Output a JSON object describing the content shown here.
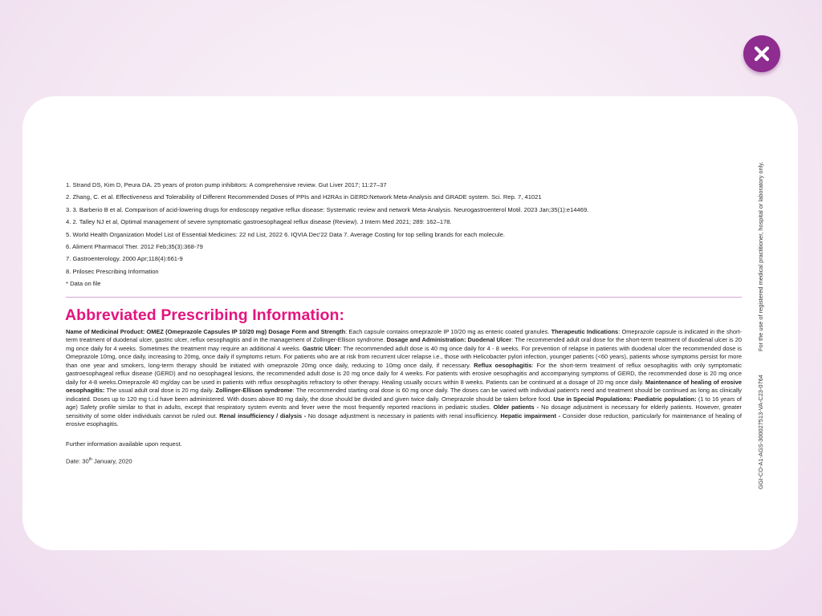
{
  "close_button": {
    "label": "close"
  },
  "references": [
    "1. Strand DS, Kim D, Peura DA. 25 years of proton pump inhibitors: A comprehensive review. Gut Liver 2017; 11:27–37",
    "2. Zhang, C. et al. Effectiveness and Tolerability of Different Recommended Doses of PPIs and H2RAs in GERD:Network Meta-Analysis and GRADE system. Sci. Rep. 7, 41021",
    "3. 3. Barberio B et al. Comparison of acid-lowering drugs for endoscopy negative reflux disease: Systematic review and network Meta-Analysis. Neurogastroenterol Motil. 2023 Jan;35(1):e14469.",
    "4. 2. Talley NJ et al, Optimal management of severe symptomatic gastroesophageal reflux disease (Review). J Intern Med 2021; 289: 162–178.",
    "5. World Health Organization Model List of Essential Medicines: 22 nd List, 2022  6. IQVIA Dec'22 Data  7. Average Costing for top selling brands for each molecule.",
    "6. Aliment Pharmacol Ther. 2012 Feb;35(3):368-79",
    "7. Gastroenterology. 2000 Apr;118(4):661-9",
    "8. Prilosec Prescribing Information",
    "* Data on file"
  ],
  "api": {
    "title": "Abbreviated Prescribing Information:",
    "segments": [
      {
        "bold": true,
        "text": "Name of Medicinal Product: OMEZ (Omeprazole Capsules IP 10/20 mg) Dosage Form and Strength"
      },
      {
        "bold": false,
        "text": ": Each capsule contains omeprazole IP 10/20 mg as enteric coated granules. "
      },
      {
        "bold": true,
        "text": "Therapeutic Indications"
      },
      {
        "bold": false,
        "text": ": Omeprazole capsule is indicated in the short-term treatment of duodenal ulcer, gastric ulcer, reflux oesophagitis and in the management of Zollinger-Ellison syndrome. "
      },
      {
        "bold": true,
        "text": "Dosage and Administration: Duodenal Ulcer"
      },
      {
        "bold": false,
        "text": ": The recommended adult oral dose for the short-term treatment of duodenal ulcer is 20 mg once daily for 4 weeks. Sometimes the treatment may require an additional 4 weeks. "
      },
      {
        "bold": true,
        "text": "Gastric Ulcer"
      },
      {
        "bold": false,
        "text": ": The recommended adult dose is 40 mg once daily for 4 - 8 weeks. For prevention of relapse in patients with duodenal ulcer the recommended dose is Omeprazole 10mg, once daily, increasing to 20mg, once daily if symptoms return. For patients who are at risk from recurrent ulcer relapse i.e., those with Helicobacter pylori infection, younger patients (<60 years), patients whose symptoms persist for more than one year and smokers, long-term therapy should be initiated with omeprazole 20mg once daily, reducing to 10mg once daily, if necessary. "
      },
      {
        "bold": true,
        "text": "Reflux oesophagitis"
      },
      {
        "bold": false,
        "text": ": For the short-term treatment of reflux oesophagitis with only symptomatic gastroesophageal reflux disease (GERD) and no oesophageal lesions, the recommended adult dose is 20 mg once daily for 4 weeks. For patients with erosive oesophagitis and accompanying symptoms of GERD, the recommended dose is 20 mg once daily for 4-8 weeks.Omeprazole 40 mg/day can be used in patients with reflux oesophagitis refractory to other therapy. Healing usually occurs within 8 weeks. Patients can be continued at a dosage of 20 mg once daily. "
      },
      {
        "bold": true,
        "text": "Maintenance of healing of erosive oesophagitis:"
      },
      {
        "bold": false,
        "text": " The usual adult oral dose is 20 mg daily. "
      },
      {
        "bold": true,
        "text": "Zollinger-Ellison syndrome"
      },
      {
        "bold": false,
        "text": ": The recommended starting oral dose is 60 mg once daily. The doses can be varied with individual patient's need and treatment should be continued as long as clinically indicated. Doses up to 120 mg t.i.d have been administered. With doses above 80 mg daily, the dose should be divided and given twice daily. Omeprazole should be taken before food. "
      },
      {
        "bold": true,
        "text": "Use in Special Populations: Paediatric population:"
      },
      {
        "bold": false,
        "text": " (1 to 16 years of age) Safety profile similar to that in adults, except that respiratory system events and fever were the most frequently reported reactions in pediatric studies. "
      },
      {
        "bold": true,
        "text": "Older patients -"
      },
      {
        "bold": false,
        "text": " No dosage adjustment is necessary for elderly patients. However, greater sensitivity of some older individuals cannot be ruled out. "
      },
      {
        "bold": true,
        "text": "Renal insufficiency / dialysis -"
      },
      {
        "bold": false,
        "text": " No dosage adjustment is necessary in patients with renal insufficiency. "
      },
      {
        "bold": true,
        "text": "Hepatic impairment -"
      },
      {
        "bold": false,
        "text": " Consider dose reduction, particularly for maintenance of healing of erosive esophagitis."
      }
    ]
  },
  "further_info": "Further information available upon request.",
  "date": {
    "prefix": "Date: 30",
    "sup": "th",
    "suffix": " January, 2020"
  },
  "side_legal": "For the use of registered medical practitioner, hospital or laboratory only.",
  "side_code": "GGI-CO-A1-AGS-300027513-VA-C23-0764",
  "colors": {
    "accent": "#e3147e",
    "close_bg": "#8e2c8f",
    "divider": "#d9a6d4"
  }
}
